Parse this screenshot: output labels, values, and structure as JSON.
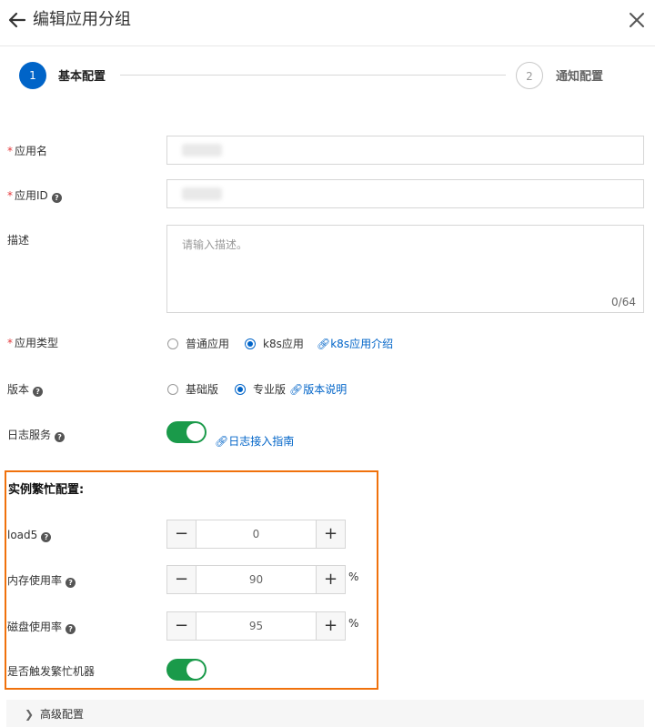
{
  "header": {
    "title": "编辑应用分组"
  },
  "steps": [
    {
      "number": "1",
      "label": "基本配置"
    },
    {
      "number": "2",
      "label": "通知配置"
    }
  ],
  "form": {
    "app_name": {
      "label": "应用名",
      "required_mark": "*"
    },
    "app_id": {
      "label": "应用ID",
      "required_mark": "*"
    },
    "description": {
      "label": "描述",
      "placeholder": "请输入描述。",
      "counter": "0/64"
    },
    "app_type": {
      "label": "应用类型",
      "required_mark": "*",
      "options": [
        "普通应用",
        "k8s应用"
      ],
      "selected": "k8s应用",
      "link": "k8s应用介绍"
    },
    "version": {
      "label": "版本",
      "options": [
        "基础版",
        "专业版"
      ],
      "selected": "专业版",
      "link": "版本说明"
    },
    "log_service": {
      "label": "日志服务",
      "enabled": true,
      "link": "日志接入指南"
    }
  },
  "busy_config": {
    "title": "实例繁忙配置:",
    "load5": {
      "label": "load5",
      "value": "0",
      "unit": ""
    },
    "memory": {
      "label": "内存使用率",
      "value": "90",
      "unit": "%"
    },
    "disk": {
      "label": "磁盘使用率",
      "value": "95",
      "unit": "%"
    },
    "trigger": {
      "label": "是否触发繁忙机器",
      "enabled": true
    }
  },
  "advanced": {
    "label": "高级配置"
  },
  "colors": {
    "primary": "#0064c8",
    "toggle_on": "#1a9a4a",
    "highlight_border": "#f0710c",
    "required": "#e4393c"
  }
}
